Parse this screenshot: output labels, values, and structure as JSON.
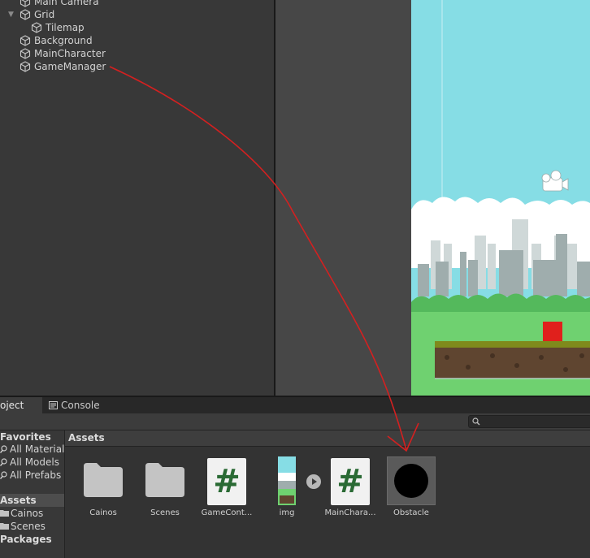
{
  "hierarchy": {
    "items": [
      {
        "label": "Main Camera"
      },
      {
        "label": "Grid"
      },
      {
        "label": "Tilemap"
      },
      {
        "label": "Background"
      },
      {
        "label": "MainCharacter"
      },
      {
        "label": "GameManager"
      }
    ]
  },
  "tabs": {
    "project": "oject",
    "console": "Console"
  },
  "project_sidebar": {
    "favorites": "Favorites",
    "fav_items": [
      "All Materials",
      "All Models",
      "All Prefabs"
    ],
    "assets": "Assets",
    "asset_items": [
      "Cainos",
      "Scenes"
    ],
    "packages": "Packages"
  },
  "assets": {
    "title": "Assets",
    "items": [
      {
        "label": "Cainos",
        "icon": "folder-icon"
      },
      {
        "label": "Scenes",
        "icon": "folder-icon"
      },
      {
        "label": "GameCont...",
        "icon": "csharp-script-icon"
      },
      {
        "label": "img",
        "icon": "sprite-thumbnail"
      },
      {
        "label": "MainChara...",
        "icon": "csharp-script-icon"
      },
      {
        "label": "Obstacle",
        "icon": "black-circle-sprite"
      }
    ],
    "script_glyph": "#"
  },
  "annotation": {
    "color": "#d42020"
  },
  "colors": {
    "sky": "#86dde5",
    "grass": "#6fd170",
    "obstacle": "#e0201c"
  }
}
